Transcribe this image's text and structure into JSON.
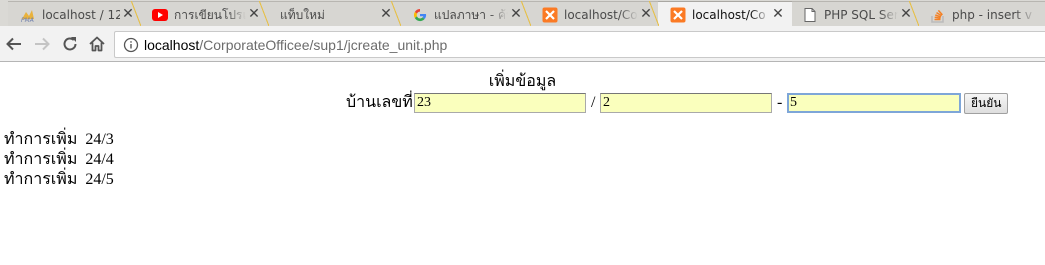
{
  "browser": {
    "tabs": [
      {
        "title": "localhost / 12",
        "icon": "phpmyadmin-icon",
        "active": false
      },
      {
        "title": "การเขียนโปรแกรม",
        "icon": "youtube-icon",
        "active": false
      },
      {
        "title": "แท็บใหม่",
        "icon": "",
        "active": false
      },
      {
        "title": "แปลภาษา - ค้นหา",
        "icon": "google-icon",
        "active": false
      },
      {
        "title": "localhost/Co",
        "icon": "xampp-icon",
        "active": false
      },
      {
        "title": "localhost/Co",
        "icon": "xampp-icon",
        "active": true
      },
      {
        "title": "PHP SQL Ser",
        "icon": "document-icon",
        "active": false
      },
      {
        "title": "php - insert v",
        "icon": "stackoverflow-icon",
        "active": false
      }
    ],
    "close_glyph": "✕",
    "address": {
      "host": "localhost",
      "path": "/CorporateOfficee/sup1/jcreate_unit.php"
    },
    "colors": {
      "tab_separator": "#e6c04a",
      "youtube": "#ff0000",
      "xampp": "#fb7a24",
      "stackoverflow": "#f48024"
    }
  },
  "page": {
    "heading": "เพิ่มข้อมูล",
    "form": {
      "house_label": "บ้านเลขที่",
      "field1_value": "23",
      "slash": "/",
      "field2_value": "2",
      "dash": "-",
      "field3_value": "5",
      "submit_label": "ยืนยัน"
    },
    "results": [
      {
        "text": "ทำการเพิ่ม",
        "value": "24/3"
      },
      {
        "text": "ทำการเพิ่ม",
        "value": "24/4"
      },
      {
        "text": "ทำการเพิ่ม",
        "value": "24/5"
      }
    ],
    "input_bg": "#faffbd",
    "focus_color": "#7ea6d8"
  }
}
